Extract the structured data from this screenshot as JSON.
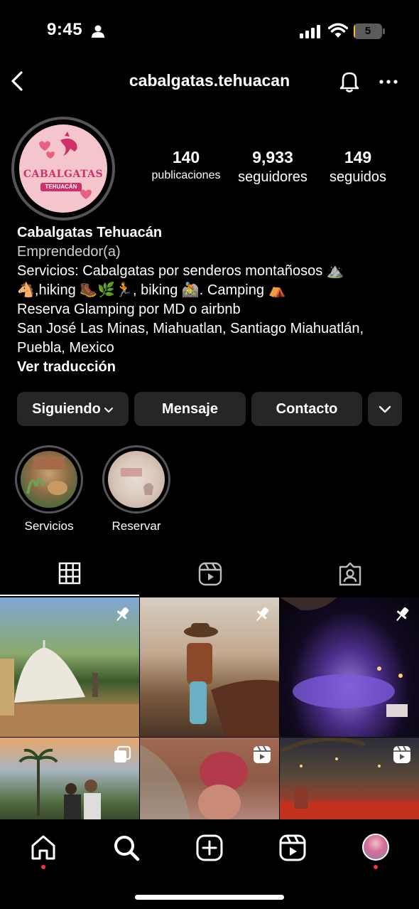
{
  "status_bar": {
    "time": "9:45",
    "battery": "5",
    "battery_level": 0.05
  },
  "header": {
    "username": "cabalgatas.tehuacan"
  },
  "profile": {
    "avatar_text": "CABALGATAS",
    "avatar_subtext": "TEHUACÁN",
    "stats": [
      {
        "value": "140",
        "label": "publicaciones"
      },
      {
        "value": "9,933",
        "label": "seguidores"
      },
      {
        "value": "149",
        "label": "seguidos"
      }
    ],
    "name": "Cabalgatas Tehuacán",
    "category": "Emprendedor(a)",
    "bio_lines": [
      "Servicios: Cabalgatas por senderos montañosos ⛰️",
      "🐴,hiking 🥾🌿🏃, biking 🚵. Camping ⛺",
      "Reserva Glamping por MD o airbnb",
      "San José Las Minas, Miahuatlan, Santiago Miahuatlán,",
      "Puebla, Mexico"
    ],
    "translate": "Ver traducción"
  },
  "actions": {
    "following": "Siguiendo",
    "message": "Mensaje",
    "contact": "Contacto"
  },
  "highlights": [
    {
      "label": "Servicios"
    },
    {
      "label": "Reservar"
    }
  ],
  "colors": {
    "background": "#000000",
    "button": "#262626",
    "notification_dot": "#ff3040"
  },
  "icons": {
    "tabs": [
      "grid-icon",
      "reels-icon",
      "tagged-icon"
    ],
    "nav": [
      "home-icon",
      "search-icon",
      "create-icon",
      "reels-icon",
      "profile-icon"
    ]
  }
}
